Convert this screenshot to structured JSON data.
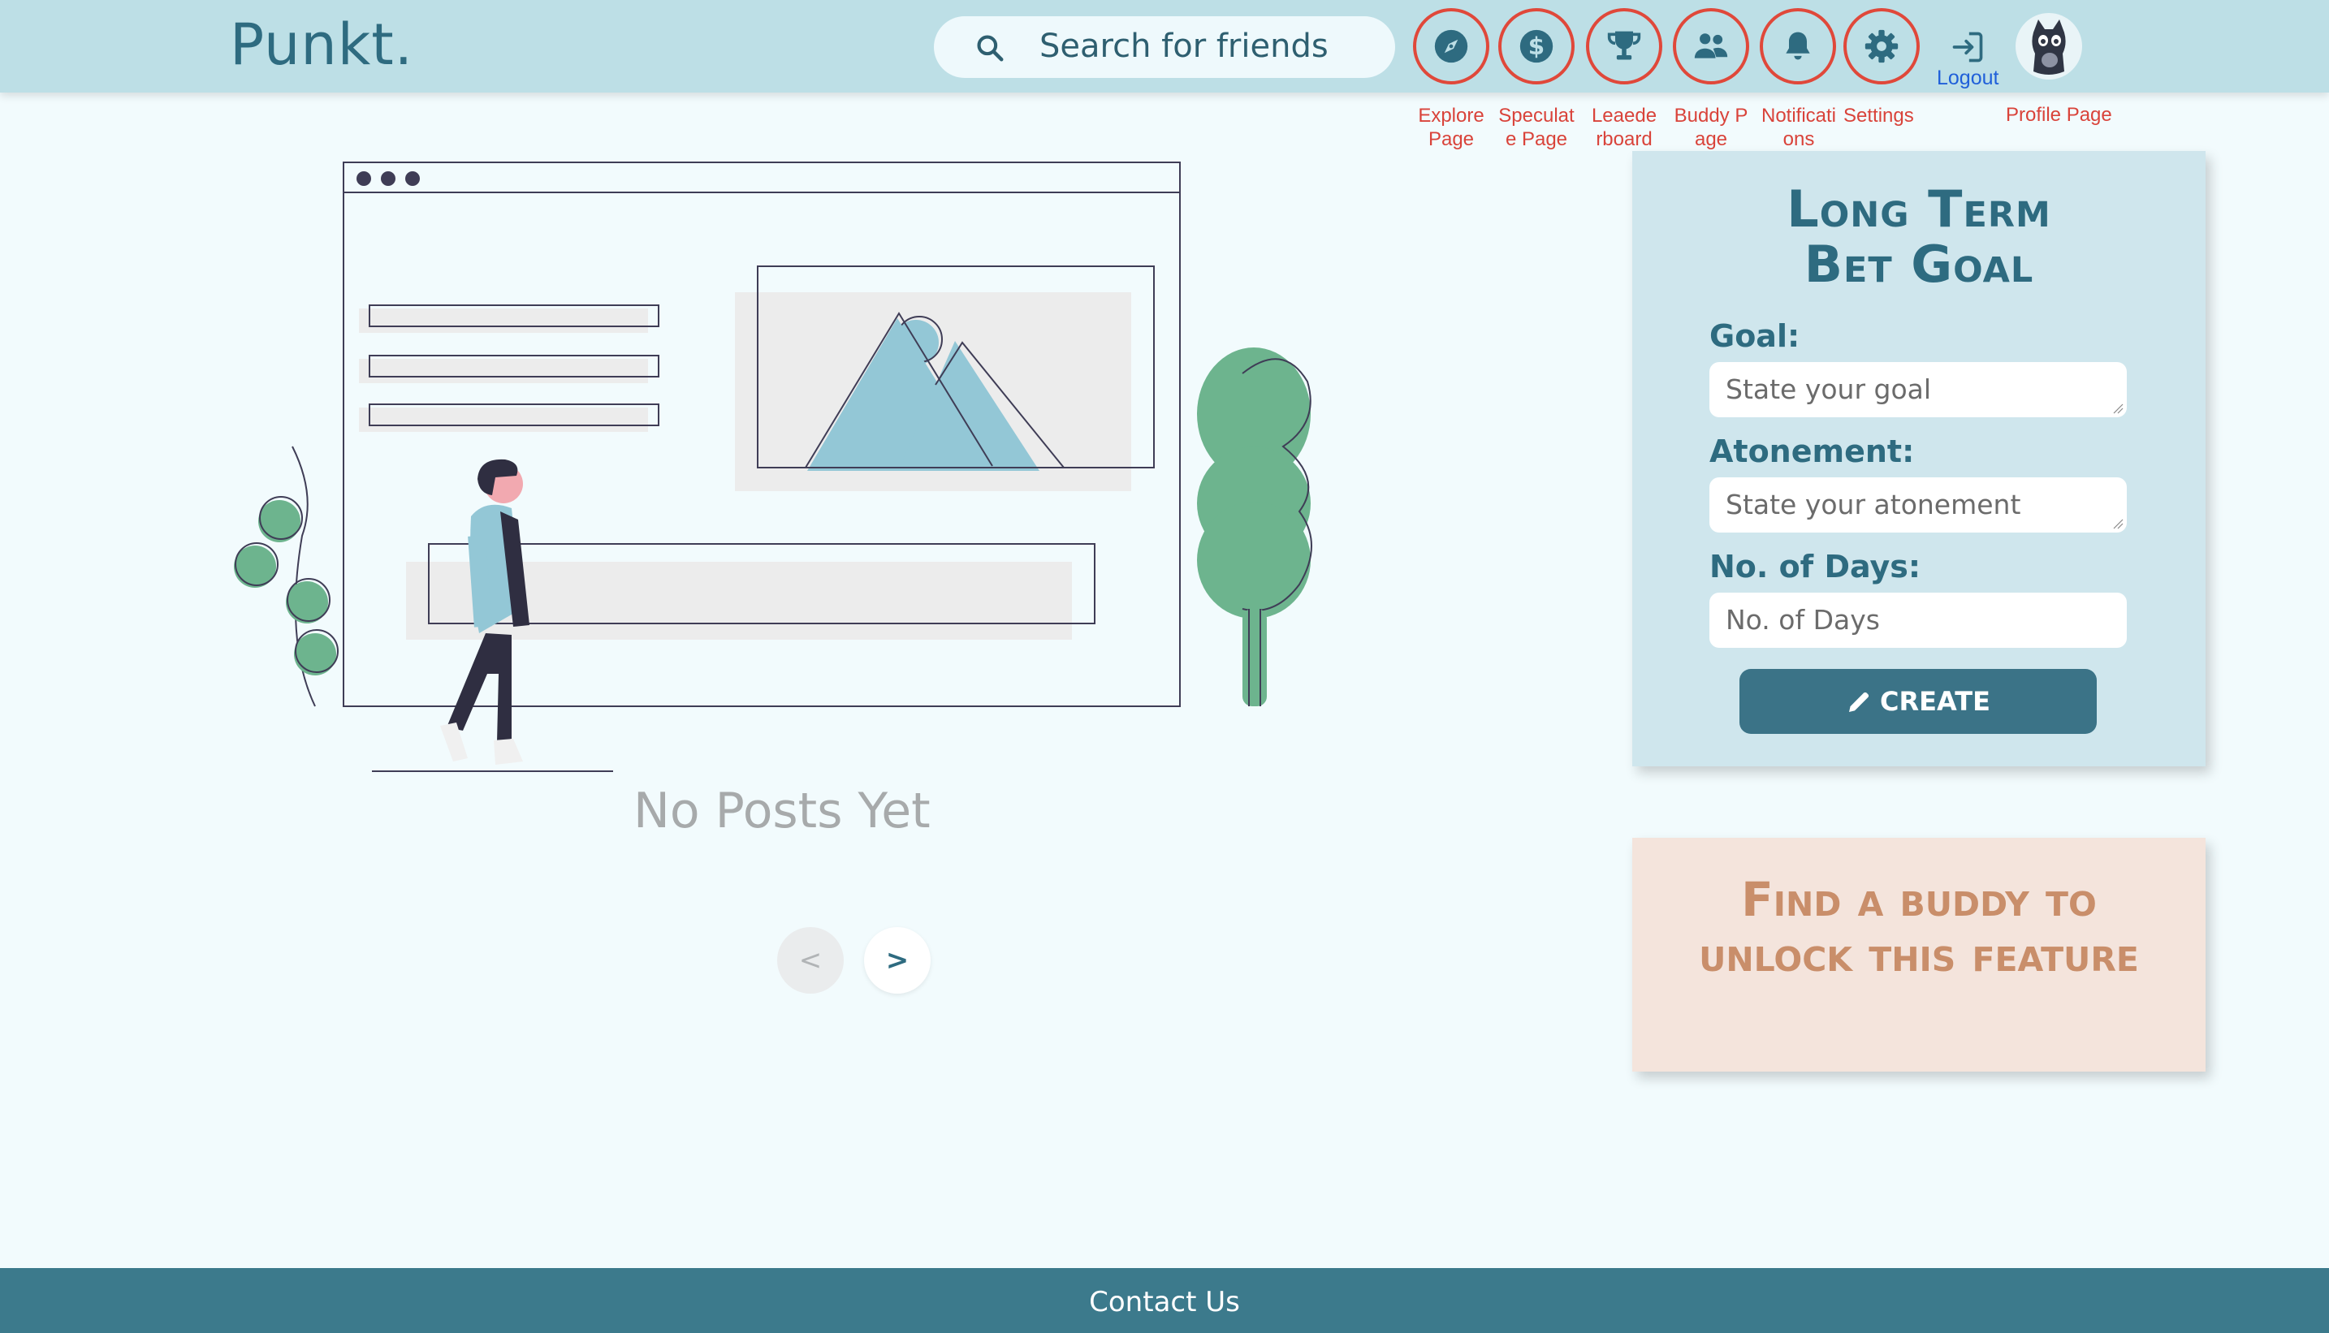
{
  "header": {
    "logo": "Punkt.",
    "search_text": "Search for friends",
    "nav": [
      {
        "label": "Explore Page",
        "icon": "compass-icon"
      },
      {
        "label": "Speculate Page",
        "icon": "dollar-icon"
      },
      {
        "label": "Leaederboard",
        "icon": "trophy-icon"
      },
      {
        "label": "Buddy Page",
        "icon": "users-icon"
      },
      {
        "label": "Notifications",
        "icon": "bell-icon"
      },
      {
        "label": "Settings",
        "icon": "gear-icon"
      }
    ],
    "logout_label": "Logout",
    "profile_label": "Profile Page"
  },
  "main": {
    "empty_message": "No Posts Yet",
    "prev_label": "<",
    "next_label": ">"
  },
  "bet_card": {
    "title": "Long Term Bet Goal",
    "goal_label": "Goal:",
    "goal_placeholder": "State your goal",
    "atonement_label": "Atonement:",
    "atonement_placeholder": "State your atonement",
    "days_label": "No. of Days:",
    "days_placeholder": "No. of Days",
    "create_label": "CREATE"
  },
  "buddy_card": {
    "message": "Find a buddy to unlock this feature"
  },
  "footer": {
    "contact": "Contact Us"
  },
  "colors": {
    "header_bg": "#bddfe6",
    "accent": "#2e6b80",
    "nav_ring": "#e0483a",
    "footer_bg": "#3c7a8c",
    "buddy_card_bg": "#f4e4dc"
  }
}
